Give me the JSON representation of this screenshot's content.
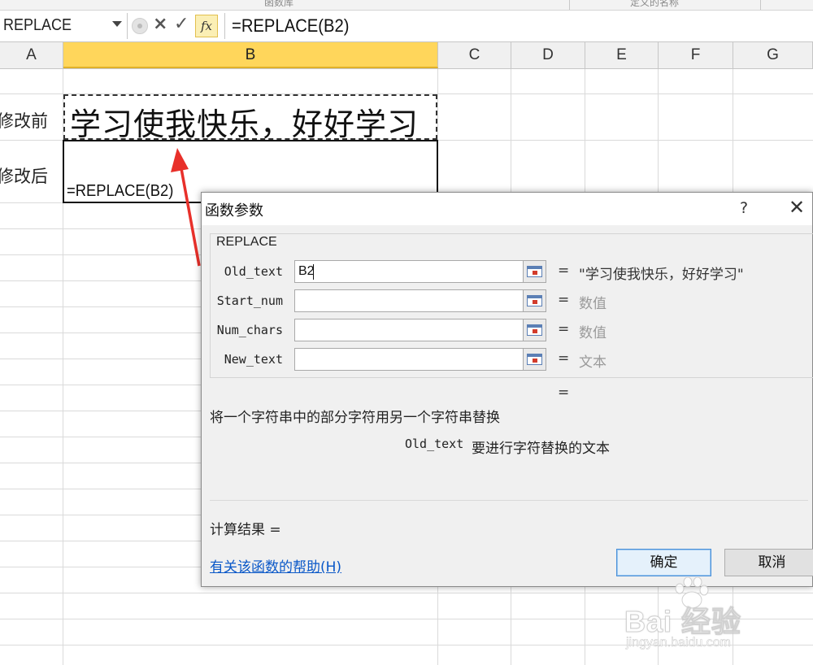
{
  "ribbon": {
    "group_left": "函数库",
    "group_right": "定义的名称"
  },
  "formula_bar": {
    "name_box": "REPLACE",
    "cancel_icon": "×",
    "enter_icon": "✓",
    "fx_label": "fx",
    "formula": "=REPLACE(B2)"
  },
  "columns": [
    "A",
    "B",
    "C",
    "D",
    "E",
    "F",
    "G"
  ],
  "selected_column": "B",
  "sheet": {
    "row1_label": "修改前",
    "row2_label": "修改后",
    "b1_text": "学习使我快乐，好好学习",
    "b2_text": "=REPLACE(B2)"
  },
  "dialog": {
    "title": "函数参数",
    "help_icon": "?",
    "close_icon": "✕",
    "function_name": "REPLACE",
    "args": [
      {
        "label": "Old_text",
        "value": "B2",
        "result": "\"学习使我快乐，好好学习\""
      },
      {
        "label": "Start_num",
        "value": "",
        "result": "数值"
      },
      {
        "label": "Num_chars",
        "value": "",
        "result": "数值"
      },
      {
        "label": "New_text",
        "value": "",
        "result": "文本"
      }
    ],
    "equals": "=",
    "description": "将一个字符串中的部分字符用另一个字符串替换",
    "arg_desc_name": "Old_text",
    "arg_desc_text": "要进行字符替换的文本",
    "calc_result": "计算结果 =",
    "help_link": "有关该函数的帮助(H)",
    "ok": "确定",
    "cancel": "取消"
  },
  "watermark": {
    "brand": "Bai  经验",
    "url": "jingyan.baidu.com"
  },
  "colors": {
    "selected_header": "#ffd65b",
    "arrow": "#e8302a",
    "link": "#0a58c8",
    "ok_border": "#4a90d9"
  }
}
